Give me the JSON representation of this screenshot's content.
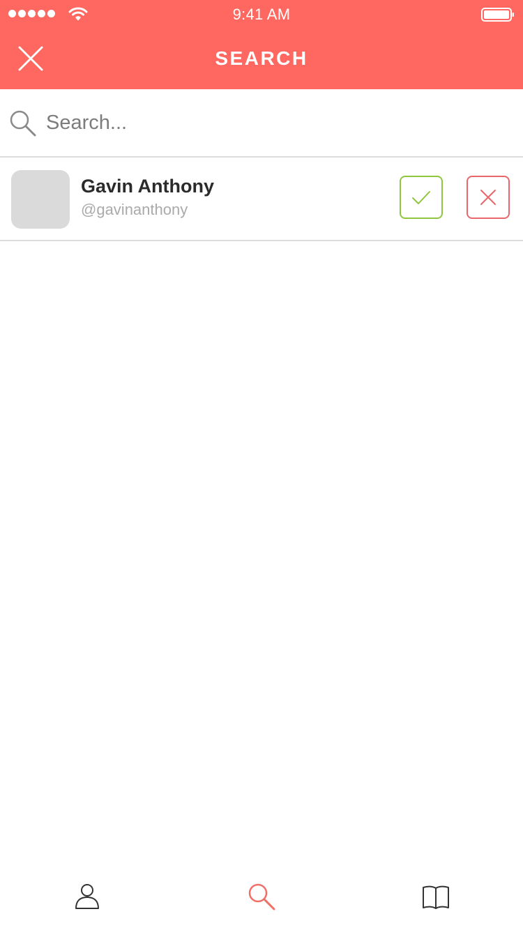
{
  "status_bar": {
    "time": "9:41 AM",
    "signal_icon": "signal-dots-icon",
    "wifi_icon": "wifi-icon",
    "battery_icon": "battery-icon"
  },
  "nav": {
    "title": "SEARCH",
    "close_icon": "close-icon"
  },
  "search": {
    "placeholder": "Search...",
    "value": "",
    "icon": "search-icon"
  },
  "results": [
    {
      "name": "Gavin Anthony",
      "handle": "@gavinanthony",
      "accept_icon": "checkmark-icon",
      "decline_icon": "close-icon"
    }
  ],
  "tab_bar": {
    "tabs": [
      {
        "icon": "person-icon",
        "active": false
      },
      {
        "icon": "search-icon",
        "active": true
      },
      {
        "icon": "book-icon",
        "active": false
      }
    ]
  },
  "colors": {
    "brand": "#ff6860",
    "accept": "#8fc63f",
    "decline": "#e9666a",
    "divider": "#dcdcdc",
    "tab_active": "#f07068",
    "tab_inactive": "#333333"
  }
}
